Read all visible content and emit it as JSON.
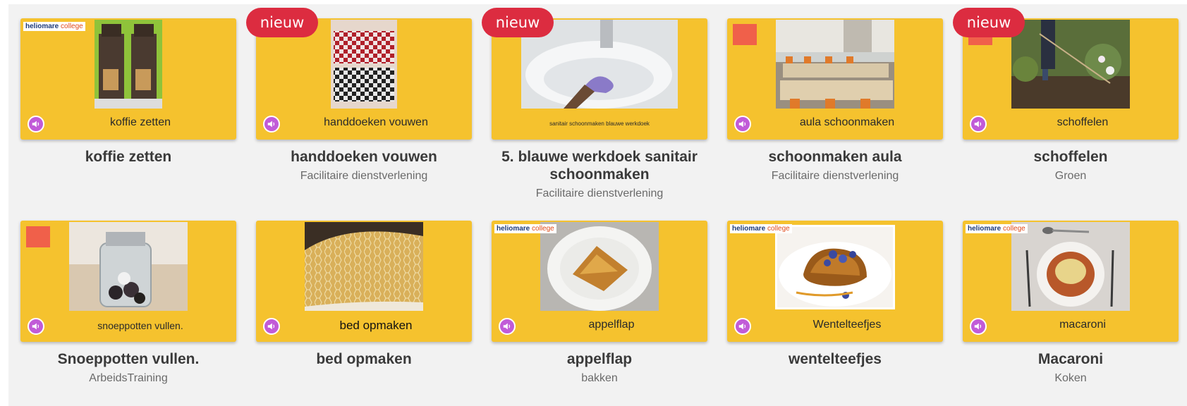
{
  "badge_text": "nieuw",
  "logo_text": {
    "brand": "heliomare",
    "suffix": "college"
  },
  "colors": {
    "card_bg": "#f5c22e",
    "badge_bg": "#dc2c40",
    "audio_bg": "#c15bd8",
    "page_bg": "#f2f2f2"
  },
  "cards": [
    {
      "thumb_label": "koffie zetten",
      "title": "koffie zetten",
      "subtitle": "",
      "is_new": false,
      "logo": "heliomare-college",
      "photo": "coffee-machines"
    },
    {
      "thumb_label": "handdoeken vouwen",
      "title": "handdoeken vouwen",
      "subtitle": "Facilitaire dienstverlening",
      "is_new": true,
      "logo": "none",
      "photo": "checkered-towels"
    },
    {
      "thumb_label": "sanitair schoonmaken blauwe werkdoek",
      "title": "5. blauwe werkdoek sanitair schoonmaken",
      "subtitle": "Facilitaire dienstverlening",
      "is_new": true,
      "logo": "none",
      "photo": "sink-cleaning"
    },
    {
      "thumb_label": "aula schoonmaken",
      "title": "schoonmaken aula",
      "subtitle": "Facilitaire dienstverlening",
      "is_new": false,
      "logo": "stapvoorstap",
      "photo": "aula-tables"
    },
    {
      "thumb_label": "schoffelen",
      "title": "schoffelen",
      "subtitle": "Groen",
      "is_new": true,
      "logo": "stapvoorstap",
      "photo": "hoeing-garden"
    },
    {
      "thumb_label": "snoeppotten vullen.",
      "title": "Snoeppotten vullen.",
      "subtitle": "ArbeidsTraining",
      "is_new": false,
      "logo": "stapvoorstap",
      "photo": "candy-jar"
    },
    {
      "thumb_label": "bed opmaken",
      "title": "bed opmaken",
      "subtitle": "",
      "is_new": false,
      "logo": "none",
      "photo": "bed-sheet"
    },
    {
      "thumb_label": "appelflap",
      "title": "appelflap",
      "subtitle": "bakken",
      "is_new": false,
      "logo": "heliomare-college",
      "photo": "apple-turnover"
    },
    {
      "thumb_label": "Wentelteefjes",
      "title": "wentelteefjes",
      "subtitle": "",
      "is_new": false,
      "logo": "heliomare-college",
      "photo": "french-toast"
    },
    {
      "thumb_label": "macaroni",
      "title": "Macaroni",
      "subtitle": "Koken",
      "is_new": false,
      "logo": "heliomare-college",
      "photo": "macaroni-plate"
    }
  ]
}
